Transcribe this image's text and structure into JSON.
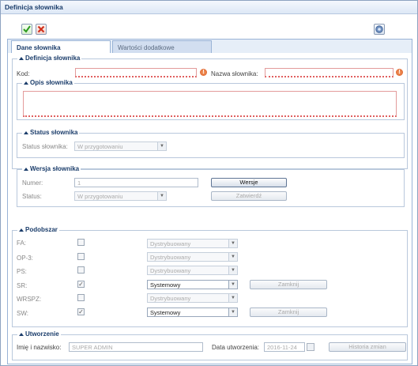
{
  "window": {
    "title": "Definicja słownika"
  },
  "toolbar": {
    "save_icon": "check-icon",
    "cancel_icon": "cross-icon",
    "help_icon": "help-icon"
  },
  "tabs": [
    {
      "label": "Dane słownika",
      "active": true
    },
    {
      "label": "Wartości dodatkowe",
      "active": false
    }
  ],
  "definicja": {
    "legend": "Definicja słownika",
    "kod_label": "Kod:",
    "kod_value": "",
    "nazwa_label": "Nazwa słownika:",
    "nazwa_value": "",
    "error_icon": "!"
  },
  "opis": {
    "legend": "Opis słownika",
    "value": ""
  },
  "status": {
    "legend": "Status słownika",
    "label": "Status słownika:",
    "value": "W przygotowaniu"
  },
  "wersja": {
    "legend": "Wersja słownika",
    "numer_label": "Numer:",
    "numer_value": "1",
    "status_label": "Status:",
    "status_value": "W przygotowaniu",
    "wersje_button": "Wersje",
    "zatwierdz_button": "Zatwierdź"
  },
  "podobszar": {
    "legend": "Podobszar",
    "rows": [
      {
        "label": "FA:",
        "checked": false,
        "value": "Dystrybuowany",
        "enabled": false,
        "button": ""
      },
      {
        "label": "OP-3:",
        "checked": false,
        "value": "Dystrybuowany",
        "enabled": false,
        "button": ""
      },
      {
        "label": "PS:",
        "checked": false,
        "value": "Dystrybuowany",
        "enabled": false,
        "button": ""
      },
      {
        "label": "SR:",
        "checked": true,
        "value": "Systemowy",
        "enabled": true,
        "button": "Zamknij"
      },
      {
        "label": "WRSPZ:",
        "checked": false,
        "value": "Dystrybuowany",
        "enabled": false,
        "button": ""
      },
      {
        "label": "SW:",
        "checked": true,
        "value": "Systemowy",
        "enabled": true,
        "button": "Zamknij"
      }
    ]
  },
  "utworzenie": {
    "legend": "Utworzenie",
    "imie_label": "Imię i nazwisko:",
    "imie_value": "SUPER ADMIN",
    "data_label": "Data utworzenia:",
    "data_value": "2016-11-24",
    "historia_button": "Historia zmian"
  },
  "colors": {
    "accent": "#1b3d6b",
    "error": "#e06060",
    "frame": "#99b3d6"
  }
}
